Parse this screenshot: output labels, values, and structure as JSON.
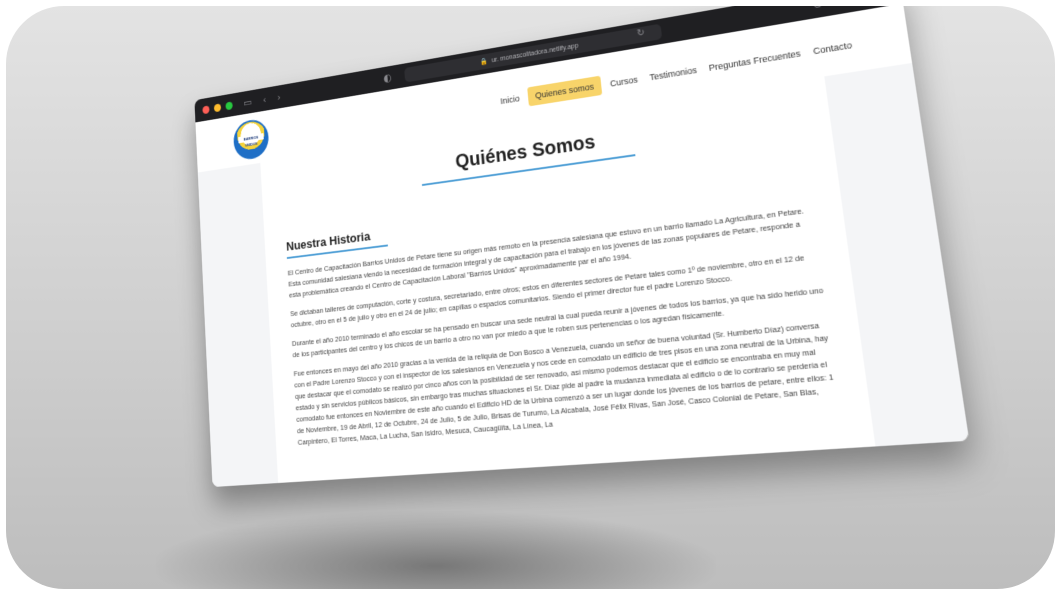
{
  "browser": {
    "url": "ur. monascolitadora.netlify.app",
    "nav_back": "‹",
    "nav_forward": "›"
  },
  "site": {
    "logo_text": "BARRIOS UNIDOS",
    "menu": [
      "Inicio",
      "Quienes somos",
      "Cursos",
      "Testimonios",
      "Preguntas Frecuentes",
      "Contacto"
    ],
    "active_menu": "Quienes somos"
  },
  "page": {
    "title": "Quiénes Somos",
    "section_title": "Nuestra Historia",
    "paragraphs": [
      "El Centro de Capacitación Barrios Unidos de Petare tiene su origen más remoto en la presencia salesiana que estuvo en un barrio llamado La Agricultura, en Petare. Esta comunidad salesiana viendo la necesidad de formación integral y de capacitación para el trabajo en los jóvenes de las zonas populares de Petare, responde a esta problemática creando el Centro de Capacitación Laboral \"Barrios Unidos\" aproximadamente par el año 1994.",
      "Se dictaban talleres de computación, corte y costura, secretariado, entre otros; estos en diferentes sectores de Petare tales como 1º de noviembre, otro en el 12 de octubre, otro en el 5 de julio y otro en el 24 de julio; en capillas o espacios comunitarios. Siendo el primer director fue el padre Lorenzo Stocco.",
      "Durante el año 2010 terminado el año escolar se ha pensado en buscar una sede neutral la cual pueda reunir a jóvenes de todos los barrios, ya que ha sido herido uno de los participantes del centro y los chicos de un barrio a otro no van por miedo a que le roben sus pertenencias o los agredan físicamente.",
      "Fue entonces en mayo del año 2010 gracias a la venida de la reliquia de Don Bosco a Venezuela, cuando un señor de buena voluntad (Sr. Humberto Díaz) conversa con el Padre Lorenzo Stocco y con el inspector de los salesianos en Venezuela y nos cede en comodato un edificio de tres pisos en una zona neutral de la Urbina, hay que destacar que el comodato se realizó por cinco años con la posibilidad de ser renovado, así mismo podemos destacar que el edificio se encontraba en muy mal estado y sin servicios públicos básicos, sin embargo tras muchas situaciones el Sr. Díaz pide al padre la mudanza inmediata al edificio o de lo contrario se perdería el comodato fue entonces en Noviembre de este año cuando el Edificio HD de la Urbina comenzó a ser un lugar donde los jóvenes de los barrios de petare, entre ellos: 1 de Noviembre, 19 de Abril, 12 de Octubre, 24 de Julio, 5 de Julio, Brisas de Turumo, La Alcabala, José Félix Rivas, San José, Casco Colonial de Petare, San Blas, Carpintero, El Torres, Maca, La Lucha, San Isidro, Mesuca, Caucagüita, La Línea, La"
    ]
  }
}
